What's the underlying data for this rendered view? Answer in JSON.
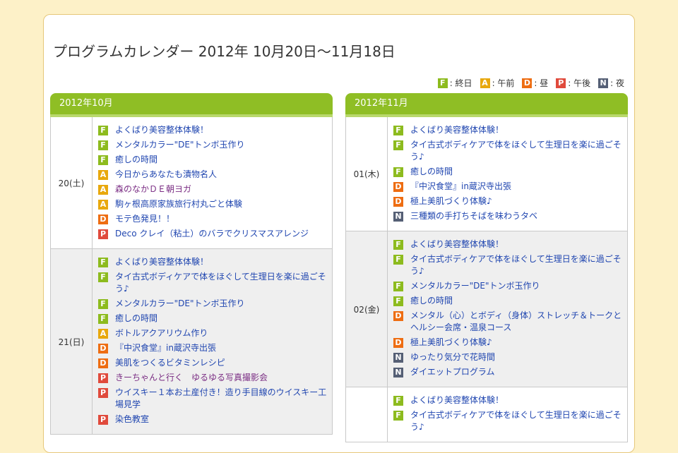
{
  "title": "プログラムカレンダー 2012年 10月20日～11月18日",
  "colors": {
    "F": "#8dbb1e",
    "A": "#e8a80d",
    "D": "#ee6d12",
    "P": "#e04a3c",
    "N": "#555f75",
    "month_header": "#8fbe25"
  },
  "legend": [
    {
      "code": "F",
      "label": ": 終日"
    },
    {
      "code": "A",
      "label": ": 午前"
    },
    {
      "code": "D",
      "label": ": 昼"
    },
    {
      "code": "P",
      "label": ": 午後"
    },
    {
      "code": "N",
      "label": ": 夜"
    }
  ],
  "months": [
    {
      "label": "2012年10月",
      "days": [
        {
          "date": "20(土)",
          "events": [
            {
              "code": "F",
              "title": "よくばり美容整体体験！"
            },
            {
              "code": "F",
              "title": "メンタルカラー\"DE\"トンボ玉作り"
            },
            {
              "code": "F",
              "title": "癒しの時間"
            },
            {
              "code": "A",
              "title": "今日からあなたも漬物名人"
            },
            {
              "code": "A",
              "title": "森のなかＤＥ朝ヨガ",
              "visited": true
            },
            {
              "code": "A",
              "title": "駒ヶ根高原家族旅行村丸ごと体験"
            },
            {
              "code": "D",
              "title": "モテ色発見！！"
            },
            {
              "code": "P",
              "title": "Deco クレイ（粘土）のバラでクリスマスアレンジ"
            }
          ]
        },
        {
          "date": "21(日)",
          "events": [
            {
              "code": "F",
              "title": "よくばり美容整体体験！"
            },
            {
              "code": "F",
              "title": "タイ古式ボディケアで体をほぐして生理日を楽に過ごそう♪"
            },
            {
              "code": "F",
              "title": "メンタルカラー\"DE\"トンボ玉作り"
            },
            {
              "code": "F",
              "title": "癒しの時間"
            },
            {
              "code": "A",
              "title": "ボトルアクアリウム作り"
            },
            {
              "code": "D",
              "title": "『中沢食堂』in蔵沢寺出張"
            },
            {
              "code": "D",
              "title": "美肌をつくるビタミンレシピ"
            },
            {
              "code": "P",
              "title": "きーちゃんと行く　ゆるゆる写真撮影会",
              "visited": true
            },
            {
              "code": "P",
              "title": "ウイスキー１本お土産付き！造り手目線のウイスキー工場見学"
            },
            {
              "code": "P",
              "title": "染色教室"
            }
          ]
        }
      ]
    },
    {
      "label": "2012年11月",
      "days": [
        {
          "date": "01(木)",
          "events": [
            {
              "code": "F",
              "title": "よくばり美容整体体験！"
            },
            {
              "code": "F",
              "title": "タイ古式ボディケアで体をほぐして生理日を楽に過ごそう♪"
            },
            {
              "code": "F",
              "title": "癒しの時間"
            },
            {
              "code": "D",
              "title": "『中沢食堂』in蔵沢寺出張"
            },
            {
              "code": "D",
              "title": "極上美肌づくり体験♪"
            },
            {
              "code": "N",
              "title": "三種類の手打ちそばを味わうタベ"
            }
          ]
        },
        {
          "date": "02(金)",
          "events": [
            {
              "code": "F",
              "title": "よくばり美容整体体験！"
            },
            {
              "code": "F",
              "title": "タイ古式ボディケアで体をほぐして生理日を楽に過ごそう♪"
            },
            {
              "code": "F",
              "title": "メンタルカラー\"DE\"トンボ玉作り"
            },
            {
              "code": "F",
              "title": "癒しの時間"
            },
            {
              "code": "D",
              "title": "メンタル（心）とボディ（身体）ストレッチ＆トークとヘルシー会席・温泉コース"
            },
            {
              "code": "D",
              "title": "極上美肌づくり体験♪"
            },
            {
              "code": "N",
              "title": "ゆったり気分で花時間"
            },
            {
              "code": "N",
              "title": "ダイエットプログラム"
            }
          ]
        },
        {
          "date": "",
          "events": [
            {
              "code": "F",
              "title": "よくばり美容整体体験！"
            },
            {
              "code": "F",
              "title": "タイ古式ボディケアで体をほぐして生理日を楽に過ごそう♪"
            }
          ]
        }
      ]
    }
  ]
}
